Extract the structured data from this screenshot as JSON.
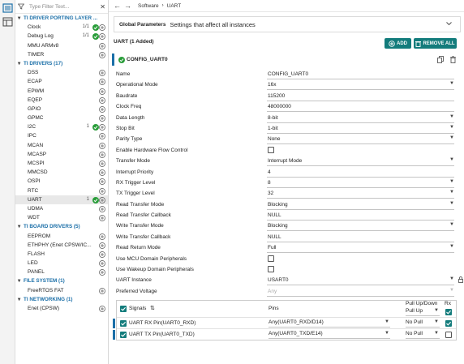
{
  "sidebar": {
    "filter_placeholder": "Type Filter Text...",
    "groups": [
      {
        "label": "TI DRIVER PORTING LAYER ...",
        "items": [
          {
            "label": "Clock",
            "count": "1/1",
            "ok": true
          },
          {
            "label": "Debug Log",
            "count": "1/1",
            "ok": true
          },
          {
            "label": "MMU ARMv8"
          },
          {
            "label": "TIMER"
          }
        ]
      },
      {
        "label": "TI DRIVERS (17)",
        "items": [
          {
            "label": "DSS"
          },
          {
            "label": "ECAP"
          },
          {
            "label": "EPWM"
          },
          {
            "label": "EQEP"
          },
          {
            "label": "GPIO"
          },
          {
            "label": "GPMC"
          },
          {
            "label": "I2C",
            "count": "1",
            "ok": true
          },
          {
            "label": "IPC"
          },
          {
            "label": "MCAN"
          },
          {
            "label": "MCASP"
          },
          {
            "label": "MCSPI"
          },
          {
            "label": "MMCSD"
          },
          {
            "label": "OSPI"
          },
          {
            "label": "RTC"
          },
          {
            "label": "UART",
            "count": "1",
            "ok": true,
            "selected": true
          },
          {
            "label": "UDMA"
          },
          {
            "label": "WDT"
          }
        ]
      },
      {
        "label": "TI BOARD DRIVERS (5)",
        "items": [
          {
            "label": "EEPROM"
          },
          {
            "label": "ETHPHY (Enet CPSW/IC..."
          },
          {
            "label": "FLASH"
          },
          {
            "label": "LED"
          },
          {
            "label": "PANEL"
          }
        ]
      },
      {
        "label": "FILE SYSTEM (1)",
        "items": [
          {
            "label": "FreeRTOS FAT"
          }
        ]
      },
      {
        "label": "TI NETWORKING (1)",
        "items": [
          {
            "label": "Enet (CPSW)"
          }
        ]
      }
    ]
  },
  "breadcrumb": {
    "root": "Software",
    "current": "UART"
  },
  "global_params": {
    "title": "Global Parameters",
    "desc": "Settings that affect all instances"
  },
  "uart_header": "UART (1 Added)",
  "buttons": {
    "add": "ADD",
    "remove_all": "REMOVE ALL"
  },
  "instance_name": "CONFIG_UART0",
  "rows": [
    {
      "label": "Name",
      "value": "CONFIG_UART0",
      "kind": "text"
    },
    {
      "label": "Operational Mode",
      "value": "16x",
      "kind": "select"
    },
    {
      "label": "Baudrate",
      "value": "115200",
      "kind": "text"
    },
    {
      "label": "Clock Freq",
      "value": "48000000",
      "kind": "text"
    },
    {
      "label": "Data Length",
      "value": "8-bit",
      "kind": "select"
    },
    {
      "label": "Stop Bit",
      "value": "1-bit",
      "kind": "select"
    },
    {
      "label": "Parity Type",
      "value": "None",
      "kind": "select"
    },
    {
      "label": "Enable Hardware Flow Control",
      "kind": "checkbox"
    },
    {
      "label": "Transfer Mode",
      "value": "Interrupt Mode",
      "kind": "select"
    },
    {
      "label": "Interrupt Priority",
      "value": "4",
      "kind": "text"
    },
    {
      "label": "RX Trigger Level",
      "value": "8",
      "kind": "select"
    },
    {
      "label": "TX Trigger Level",
      "value": "32",
      "kind": "select"
    },
    {
      "label": "Read Transfer Mode",
      "value": "Blocking",
      "kind": "select"
    },
    {
      "label": "Read Transfer Callback",
      "value": "NULL",
      "kind": "text"
    },
    {
      "label": "Write Transfer Mode",
      "value": "Blocking",
      "kind": "select"
    },
    {
      "label": "Write Transfer Callback",
      "value": "NULL",
      "kind": "text"
    },
    {
      "label": "Read Return Mode",
      "value": "Full",
      "kind": "select"
    },
    {
      "label": "Use MCU Domain Peripherals",
      "kind": "checkbox"
    },
    {
      "label": "Use Wakeup Domain Peripherals",
      "kind": "checkbox"
    },
    {
      "label": "UART Instance",
      "value": "USART0",
      "kind": "select",
      "lock": true
    },
    {
      "label": "Preferred Voltage",
      "value": "Any",
      "kind": "select",
      "disabled": true
    }
  ],
  "signals": {
    "header": {
      "signals": "Signals",
      "pins": "Pins",
      "pull": "Pull Up/Down",
      "rx": "Rx",
      "pull_value": "Pull Up"
    },
    "rows": [
      {
        "name": "UART RX Pin(UART0_RXD)",
        "pin": "Any(UART0_RXD/D14)",
        "pull": "No Pull",
        "rx": true
      },
      {
        "name": "UART TX Pin(UART0_TXD)",
        "pin": "Any(UART0_TXD/E14)",
        "pull": "No Pull",
        "rx": false
      }
    ]
  },
  "colors": {
    "accent": "#137c7c",
    "ok": "#2a9d3a",
    "link": "#1b6fa8"
  }
}
